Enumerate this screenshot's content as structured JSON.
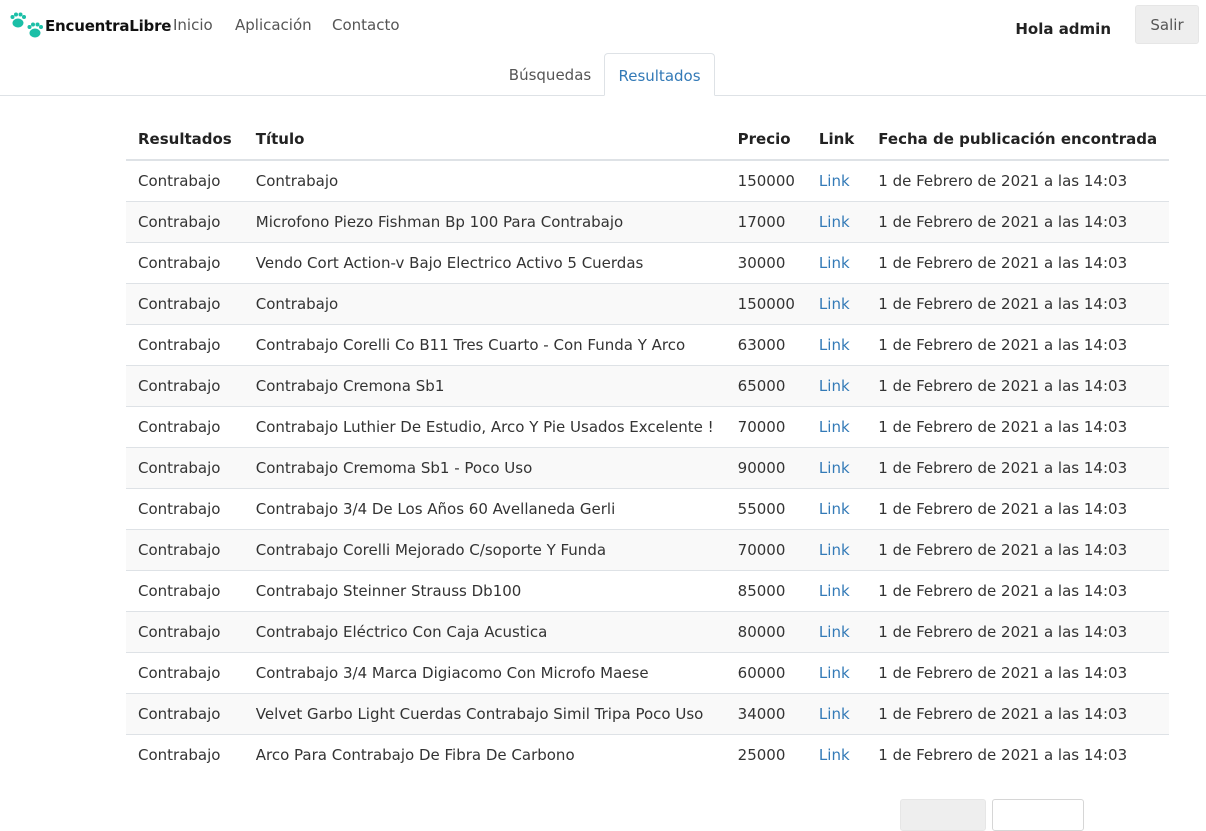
{
  "brand": {
    "name": "EncuentraLibre",
    "logo_icon": "paw-prints-icon",
    "logo_color": "#1bbfa7"
  },
  "nav": {
    "items": [
      "Inicio",
      "Aplicación",
      "Contacto"
    ]
  },
  "user": {
    "greeting": "Hola admin",
    "logout_label": "Salir"
  },
  "tabs": [
    {
      "label": "Búsquedas",
      "active": false
    },
    {
      "label": "Resultados",
      "active": true
    }
  ],
  "table": {
    "headers": [
      "Resultados",
      "Título",
      "Precio",
      "Link",
      "Fecha de publicación encontrada"
    ],
    "rows": [
      {
        "resultado": "Contrabajo",
        "titulo": "Contrabajo",
        "precio": "150000",
        "link": "Link",
        "fecha": "1 de Febrero de 2021 a las 14:03"
      },
      {
        "resultado": "Contrabajo",
        "titulo": "Microfono Piezo Fishman Bp 100 Para Contrabajo",
        "precio": "17000",
        "link": "Link",
        "fecha": "1 de Febrero de 2021 a las 14:03"
      },
      {
        "resultado": "Contrabajo",
        "titulo": "Vendo Cort Action-v Bajo Electrico Activo 5 Cuerdas",
        "precio": "30000",
        "link": "Link",
        "fecha": "1 de Febrero de 2021 a las 14:03"
      },
      {
        "resultado": "Contrabajo",
        "titulo": "Contrabajo",
        "precio": "150000",
        "link": "Link",
        "fecha": "1 de Febrero de 2021 a las 14:03"
      },
      {
        "resultado": "Contrabajo",
        "titulo": "Contrabajo Corelli Co B11 Tres Cuarto - Con Funda Y Arco",
        "precio": "63000",
        "link": "Link",
        "fecha": "1 de Febrero de 2021 a las 14:03"
      },
      {
        "resultado": "Contrabajo",
        "titulo": "Contrabajo Cremona Sb1",
        "precio": "65000",
        "link": "Link",
        "fecha": "1 de Febrero de 2021 a las 14:03"
      },
      {
        "resultado": "Contrabajo",
        "titulo": "Contrabajo Luthier De Estudio, Arco Y Pie Usados Excelente !",
        "precio": "70000",
        "link": "Link",
        "fecha": "1 de Febrero de 2021 a las 14:03"
      },
      {
        "resultado": "Contrabajo",
        "titulo": "Contrabajo Cremoma Sb1 - Poco Uso",
        "precio": "90000",
        "link": "Link",
        "fecha": "1 de Febrero de 2021 a las 14:03"
      },
      {
        "resultado": "Contrabajo",
        "titulo": "Contrabajo 3/4 De Los Años 60 Avellaneda Gerli",
        "precio": "55000",
        "link": "Link",
        "fecha": "1 de Febrero de 2021 a las 14:03"
      },
      {
        "resultado": "Contrabajo",
        "titulo": "Contrabajo Corelli Mejorado C/soporte Y Funda",
        "precio": "70000",
        "link": "Link",
        "fecha": "1 de Febrero de 2021 a las 14:03"
      },
      {
        "resultado": "Contrabajo",
        "titulo": "Contrabajo Steinner Strauss Db100",
        "precio": "85000",
        "link": "Link",
        "fecha": "1 de Febrero de 2021 a las 14:03"
      },
      {
        "resultado": "Contrabajo",
        "titulo": "Contrabajo Eléctrico Con Caja Acustica",
        "precio": "80000",
        "link": "Link",
        "fecha": "1 de Febrero de 2021 a las 14:03"
      },
      {
        "resultado": "Contrabajo",
        "titulo": "Contrabajo 3/4 Marca Digiacomo Con Microfo Maese",
        "precio": "60000",
        "link": "Link",
        "fecha": "1 de Febrero de 2021 a las 14:03"
      },
      {
        "resultado": "Contrabajo",
        "titulo": "Velvet Garbo Light Cuerdas Contrabajo Simil Tripa Poco Uso",
        "precio": "34000",
        "link": "Link",
        "fecha": "1 de Febrero de 2021 a las 14:03"
      },
      {
        "resultado": "Contrabajo",
        "titulo": "Arco Para Contrabajo De Fibra De Carbono",
        "precio": "25000",
        "link": "Link",
        "fecha": "1 de Febrero de 2021 a las 14:03"
      }
    ]
  },
  "colors": {
    "link": "#337ab7",
    "row_stripe": "#f9f9f9",
    "border": "#dee2e6"
  }
}
